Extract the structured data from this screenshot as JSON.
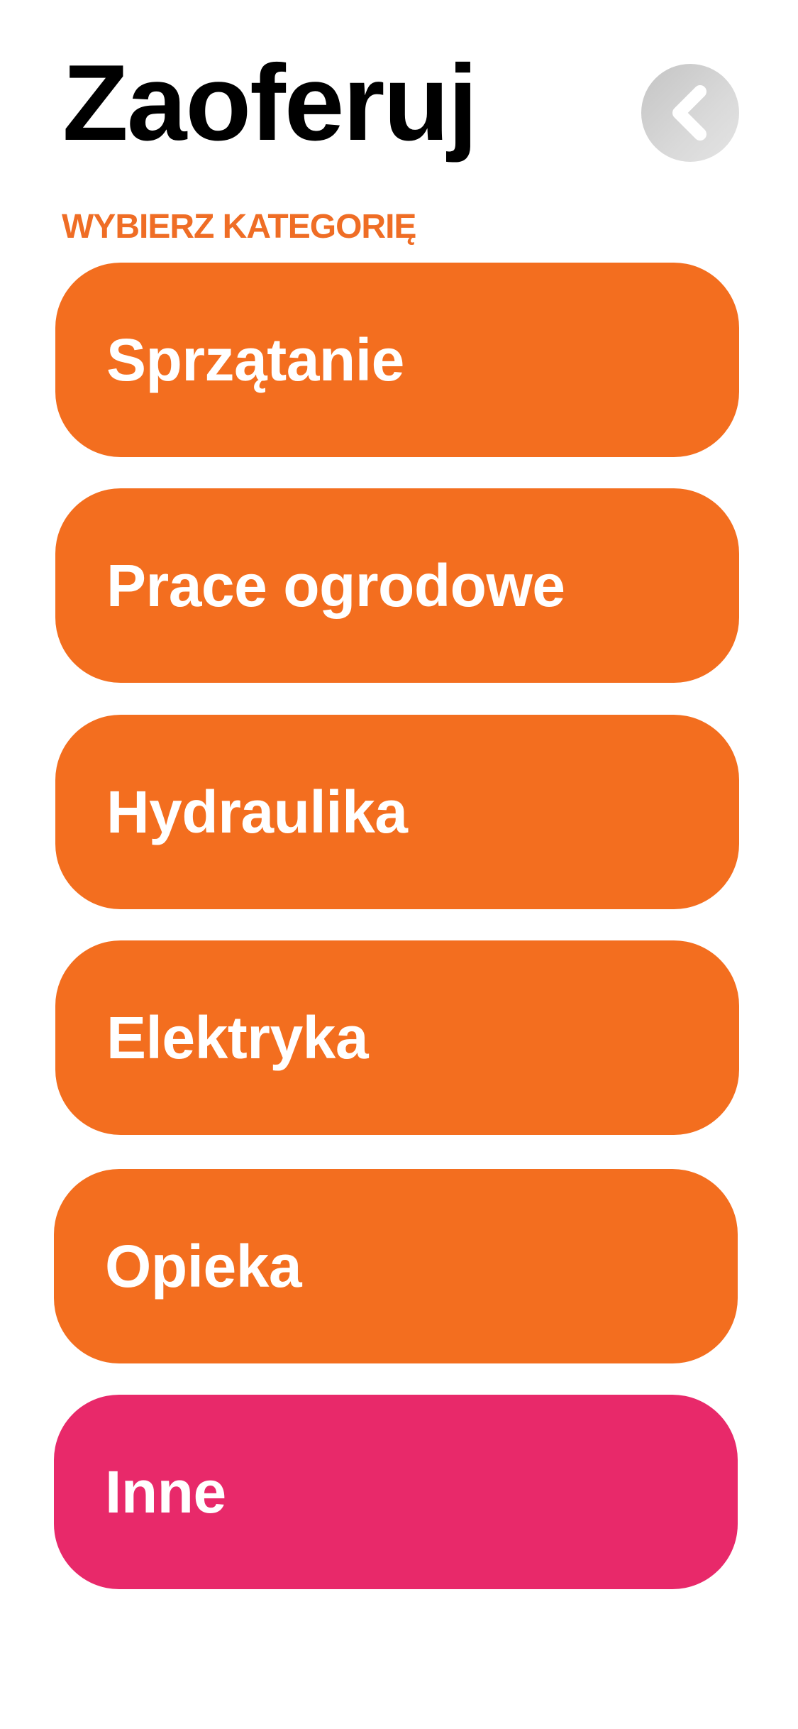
{
  "header": {
    "title": "Zaoferuj",
    "back_icon": "chevron-left-icon"
  },
  "section": {
    "label": "WYBIERZ KATEGORIĘ"
  },
  "categories": [
    {
      "label": "Sprzątanie"
    },
    {
      "label": "Prace ogrodowe"
    },
    {
      "label": "Hydraulika"
    },
    {
      "label": "Elektryka"
    },
    {
      "label": "Opieka"
    },
    {
      "label": "Inne"
    }
  ],
  "colors": {
    "accent_orange": "#f36e1f",
    "accent_pink": "#e8296a",
    "label_orange": "#ef6d25",
    "text_dark": "#000000",
    "text_light": "#ffffff"
  }
}
